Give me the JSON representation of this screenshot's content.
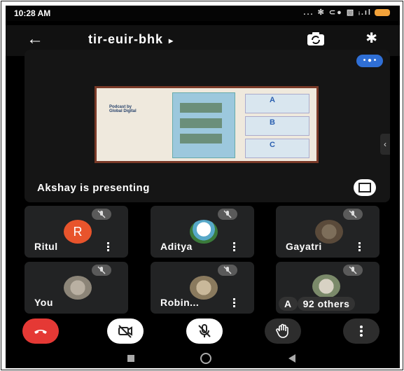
{
  "status_bar": {
    "time": "10:28 AM",
    "icons": "... ✻ ⊂● ▧ ᵢ.ıl"
  },
  "header": {
    "meeting_code": "tir-euir-bhk",
    "meeting_arrow": "▸",
    "back_icon": "arrow-left-icon",
    "camera_switch_icon": "switch-camera-icon",
    "bluetooth_icon": "bluetooth-icon"
  },
  "stage": {
    "presenting_label": "Akshay is presenting",
    "badge": "• ● •"
  },
  "slide": {
    "logo_line1": "Podcast by",
    "logo_line2": "Global Digital",
    "card_a": "A",
    "card_b": "B",
    "card_c": "C"
  },
  "participants": [
    {
      "name": "Ritul",
      "avatar_letter": "R",
      "avatar_color": "#e8542c"
    },
    {
      "name": "Aditya"
    },
    {
      "name": "Gayatri"
    },
    {
      "name": "You"
    },
    {
      "name": "Robin..."
    },
    {
      "name": "A",
      "others_label": "92 others"
    }
  ],
  "controls": {
    "end_call_color": "#e53935",
    "items": [
      "end-call-icon",
      "camera-off-icon",
      "mic-off-icon",
      "raise-hand-icon",
      "more-options-icon"
    ]
  },
  "colors": {
    "background": "#000000",
    "tile": "#222324",
    "accent_blue": "#2f6fd6"
  }
}
